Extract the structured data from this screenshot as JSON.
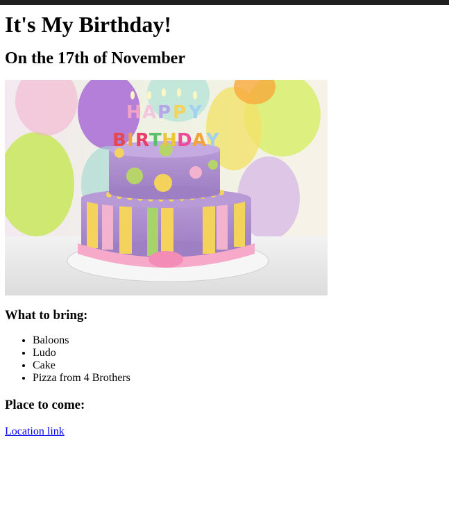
{
  "page": {
    "title": "It's My Birthday!",
    "subtitle": "On the 17th of November",
    "image": {
      "name": "birthday-cake-photo",
      "topper_text": "HAPPY BIRTHDAY"
    },
    "bring_heading": "What to bring:",
    "bring_items": [
      "Baloons",
      "Ludo",
      "Cake",
      "Pizza from 4 Brothers"
    ],
    "place_heading": "Place to come:",
    "location_link": "Location link"
  },
  "colors": {
    "link": "#0000ee",
    "topbar": "#202020",
    "text": "#000000"
  }
}
